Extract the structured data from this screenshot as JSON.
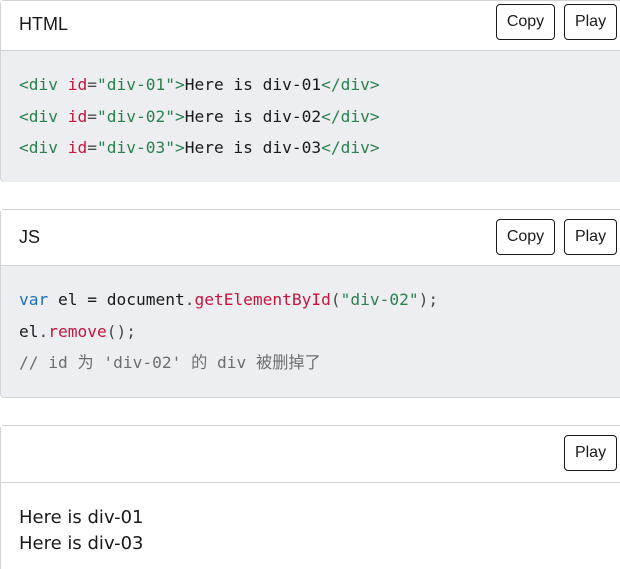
{
  "html_panel": {
    "title": "HTML",
    "copy_label": "Copy",
    "play_label": "Play",
    "lines": [
      {
        "open": "<div",
        "attr": " id",
        "eq": "=",
        "val": "\"div-01\"",
        "gt": ">",
        "text": "Here is div-01",
        "close": "</div>"
      },
      {
        "open": "<div",
        "attr": " id",
        "eq": "=",
        "val": "\"div-02\"",
        "gt": ">",
        "text": "Here is div-02",
        "close": "</div>"
      },
      {
        "open": "<div",
        "attr": " id",
        "eq": "=",
        "val": "\"div-03\"",
        "gt": ">",
        "text": "Here is div-03",
        "close": "</div>"
      }
    ]
  },
  "js_panel": {
    "title": "JS",
    "copy_label": "Copy",
    "play_label": "Play",
    "line1": {
      "kw": "var",
      "rest": " el = document",
      "dot": ".",
      "fn": "getElementById",
      "open": "(",
      "str": "\"div-02\"",
      "close": ");"
    },
    "line2": {
      "obj": "el",
      "dot": ".",
      "fn": "remove",
      "call": "();"
    },
    "line3": {
      "comment": "// id 为 'div-02' 的 div 被删掉了"
    }
  },
  "result_panel": {
    "play_label": "Play",
    "lines": [
      "Here is div-01",
      "Here is div-03"
    ]
  }
}
